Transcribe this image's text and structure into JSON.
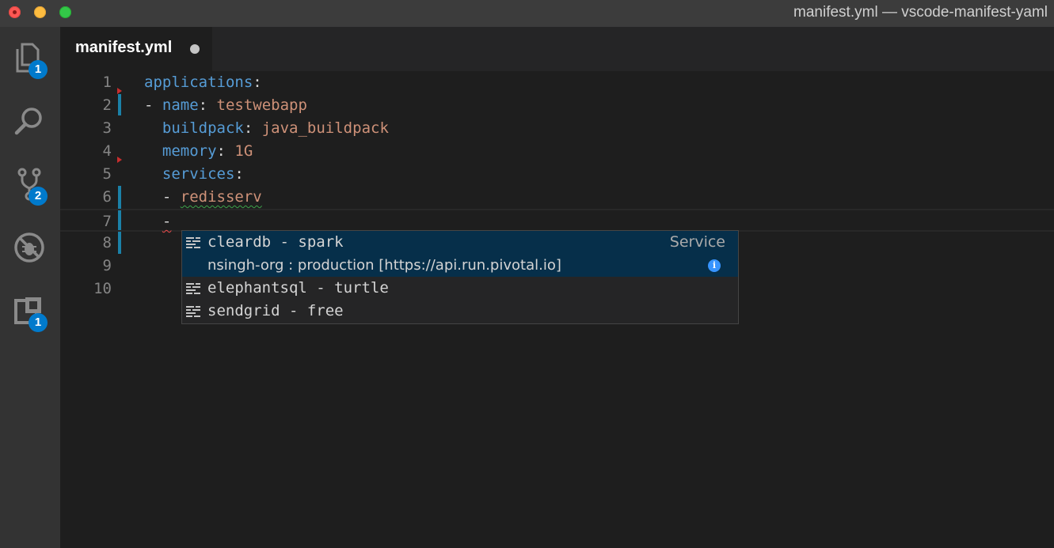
{
  "window": {
    "title": "manifest.yml — vscode-manifest-yaml"
  },
  "activity_bar": {
    "explorer_badge": "1",
    "scm_badge": "2",
    "extensions_badge": "1"
  },
  "tab": {
    "label": "manifest.yml"
  },
  "editor": {
    "lines": [
      {
        "num": "1",
        "indent": "",
        "key": "applications",
        "sep": ":",
        "value": ""
      },
      {
        "num": "2",
        "indent": "- ",
        "key": "name",
        "sep": ": ",
        "value": "testwebapp"
      },
      {
        "num": "3",
        "indent": "  ",
        "key": "buildpack",
        "sep": ": ",
        "value": "java_buildpack"
      },
      {
        "num": "4",
        "indent": "  ",
        "key": "memory",
        "sep": ": ",
        "value": "1G"
      },
      {
        "num": "5",
        "indent": "  ",
        "key": "services",
        "sep": ":",
        "value": ""
      },
      {
        "num": "6",
        "indent": "  - ",
        "key": "",
        "sep": "",
        "value": "redisserv"
      },
      {
        "num": "7",
        "indent": "  ",
        "key": "-",
        "sep": "",
        "value": ""
      },
      {
        "num": "8",
        "indent": "",
        "key": "",
        "sep": "",
        "value": ""
      },
      {
        "num": "9",
        "indent": "",
        "key": "",
        "sep": "",
        "value": ""
      },
      {
        "num": "10",
        "indent": "",
        "key": "",
        "sep": "",
        "value": ""
      }
    ]
  },
  "suggest": {
    "items": [
      {
        "label": "cleardb - spark",
        "type": "Service",
        "detail": "nsingh-org : production [https://api.run.pivotal.io]"
      },
      {
        "label": "elephantsql - turtle"
      },
      {
        "label": "sendgrid - free"
      }
    ]
  },
  "colors": {
    "accent": "#007acc",
    "key": "#569cd6",
    "string": "#ce9178",
    "selection": "#062f4a"
  }
}
